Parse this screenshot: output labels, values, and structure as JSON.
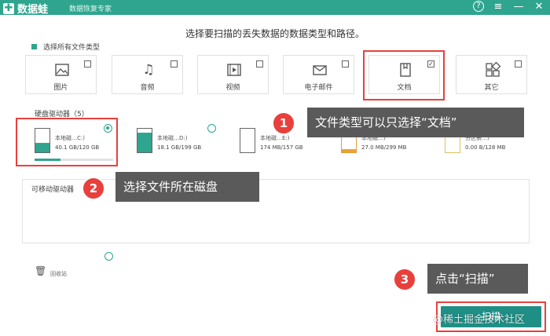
{
  "app": {
    "title": "数据蛙",
    "subtitle": "数据恢复专家",
    "help_icon": "question-icon",
    "controls": [
      "≡",
      "—",
      "✕"
    ]
  },
  "headline": "选择要扫描的丢失数据的数据类型和路径。",
  "select_all_label": "选择所有文件类型",
  "file_types": [
    {
      "label": "图片",
      "icon": "image-icon",
      "checked": false
    },
    {
      "label": "音频",
      "icon": "music-icon",
      "checked": false
    },
    {
      "label": "视频",
      "icon": "video-icon",
      "checked": false
    },
    {
      "label": "电子邮件",
      "icon": "mail-icon",
      "checked": false
    },
    {
      "label": "文档",
      "icon": "document-icon",
      "checked": true
    },
    {
      "label": "其它",
      "icon": "apps-icon",
      "checked": false
    }
  ],
  "hard_drives_label": "硬盘驱动器（5）",
  "drives": [
    {
      "name": "本地磁…C:)",
      "size": "40.1 GB/120 GB",
      "used_fraction": 0.33,
      "selected": true
    },
    {
      "name": "本地磁…D:)",
      "size": "18.1 GB/199 GB",
      "used_fraction": 0.09,
      "selected": false
    },
    {
      "name": "本地磁…E:)",
      "size": "174 MB/157 GB",
      "used_fraction": 0.01,
      "selected": false
    },
    {
      "name": "本地磁…)",
      "size": "27.0 MB/299 MB",
      "used_fraction": 0.09,
      "selected": false
    },
    {
      "name": "分区表…)",
      "size": "0.00  B/128 MB",
      "used_fraction": 0.0,
      "selected": false
    }
  ],
  "removable_label": "可移动驱动器",
  "recycle_bin_label": "回收站",
  "scan_button_label": "扫描",
  "callouts": [
    {
      "number": "1",
      "text": "文件类型可以只选择“文档”"
    },
    {
      "number": "2",
      "text": "选择文件所在磁盘"
    },
    {
      "number": "3",
      "text": "点击“扫描”"
    }
  ],
  "watermark": "@稀土掘金技术社区",
  "colors": {
    "accent": "#2fa58f",
    "highlight": "#e8403c",
    "callout_bg": "#5a5a5a",
    "scan_button": "#1f8f86"
  }
}
